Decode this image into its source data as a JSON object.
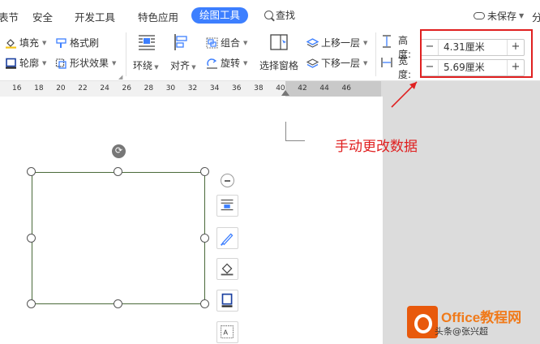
{
  "tabs": [
    "表节",
    "安全",
    "开发工具",
    "特色应用",
    "绘图工具"
  ],
  "search_label": "查找",
  "cloud_status": "未保存",
  "overflow_tab": "分",
  "ribbon": {
    "fill": "填充",
    "format_painter": "格式刷",
    "outline": "轮廓",
    "shape_effects": "形状效果",
    "wrap": "环绕",
    "align": "对齐",
    "group": "组合",
    "rotate": "旋转",
    "selection_pane": "选择窗格",
    "bring_forward": "上移一层",
    "send_backward": "下移一层",
    "height_label": "高度:",
    "height_value": "4.31厘米",
    "width_label": "宽度:",
    "width_value": "5.69厘米",
    "minus": "−",
    "plus": "+"
  },
  "ruler_ticks": [
    "16",
    "18",
    "20",
    "22",
    "24",
    "26",
    "28",
    "30",
    "32",
    "34",
    "36",
    "38",
    "40",
    "42",
    "44",
    "46"
  ],
  "annotation": "手动更改数据",
  "watermark": {
    "title": "Office教程网",
    "subtitle": "头条@张兴超"
  },
  "colors": {
    "accent": "#3d7fff",
    "annotation_red": "#e02020",
    "watermark_orange": "#e8590c"
  }
}
